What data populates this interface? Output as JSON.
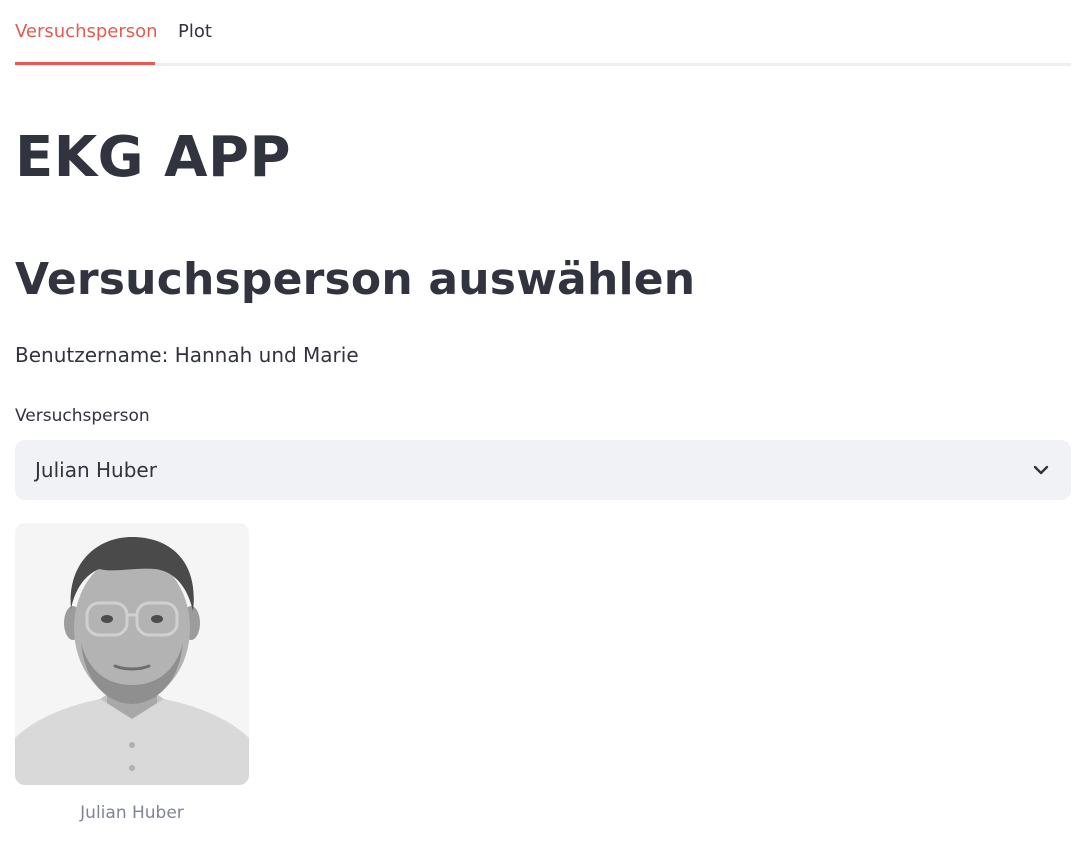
{
  "tabs": [
    {
      "label": "Versuchsperson",
      "active": true
    },
    {
      "label": "Plot",
      "active": false
    }
  ],
  "page": {
    "title": "EKG APP",
    "section_title": "Versuchsperson auswählen",
    "username_line": "Benutzername: Hannah und Marie"
  },
  "select": {
    "label": "Versuchsperson",
    "value": "Julian Huber",
    "icon": "chevron-down-icon"
  },
  "image": {
    "caption": "Julian Huber"
  },
  "colors": {
    "accent": "#e35b52",
    "text": "#31333f",
    "input_background": "#f0f2f6",
    "caption": "#808495"
  }
}
